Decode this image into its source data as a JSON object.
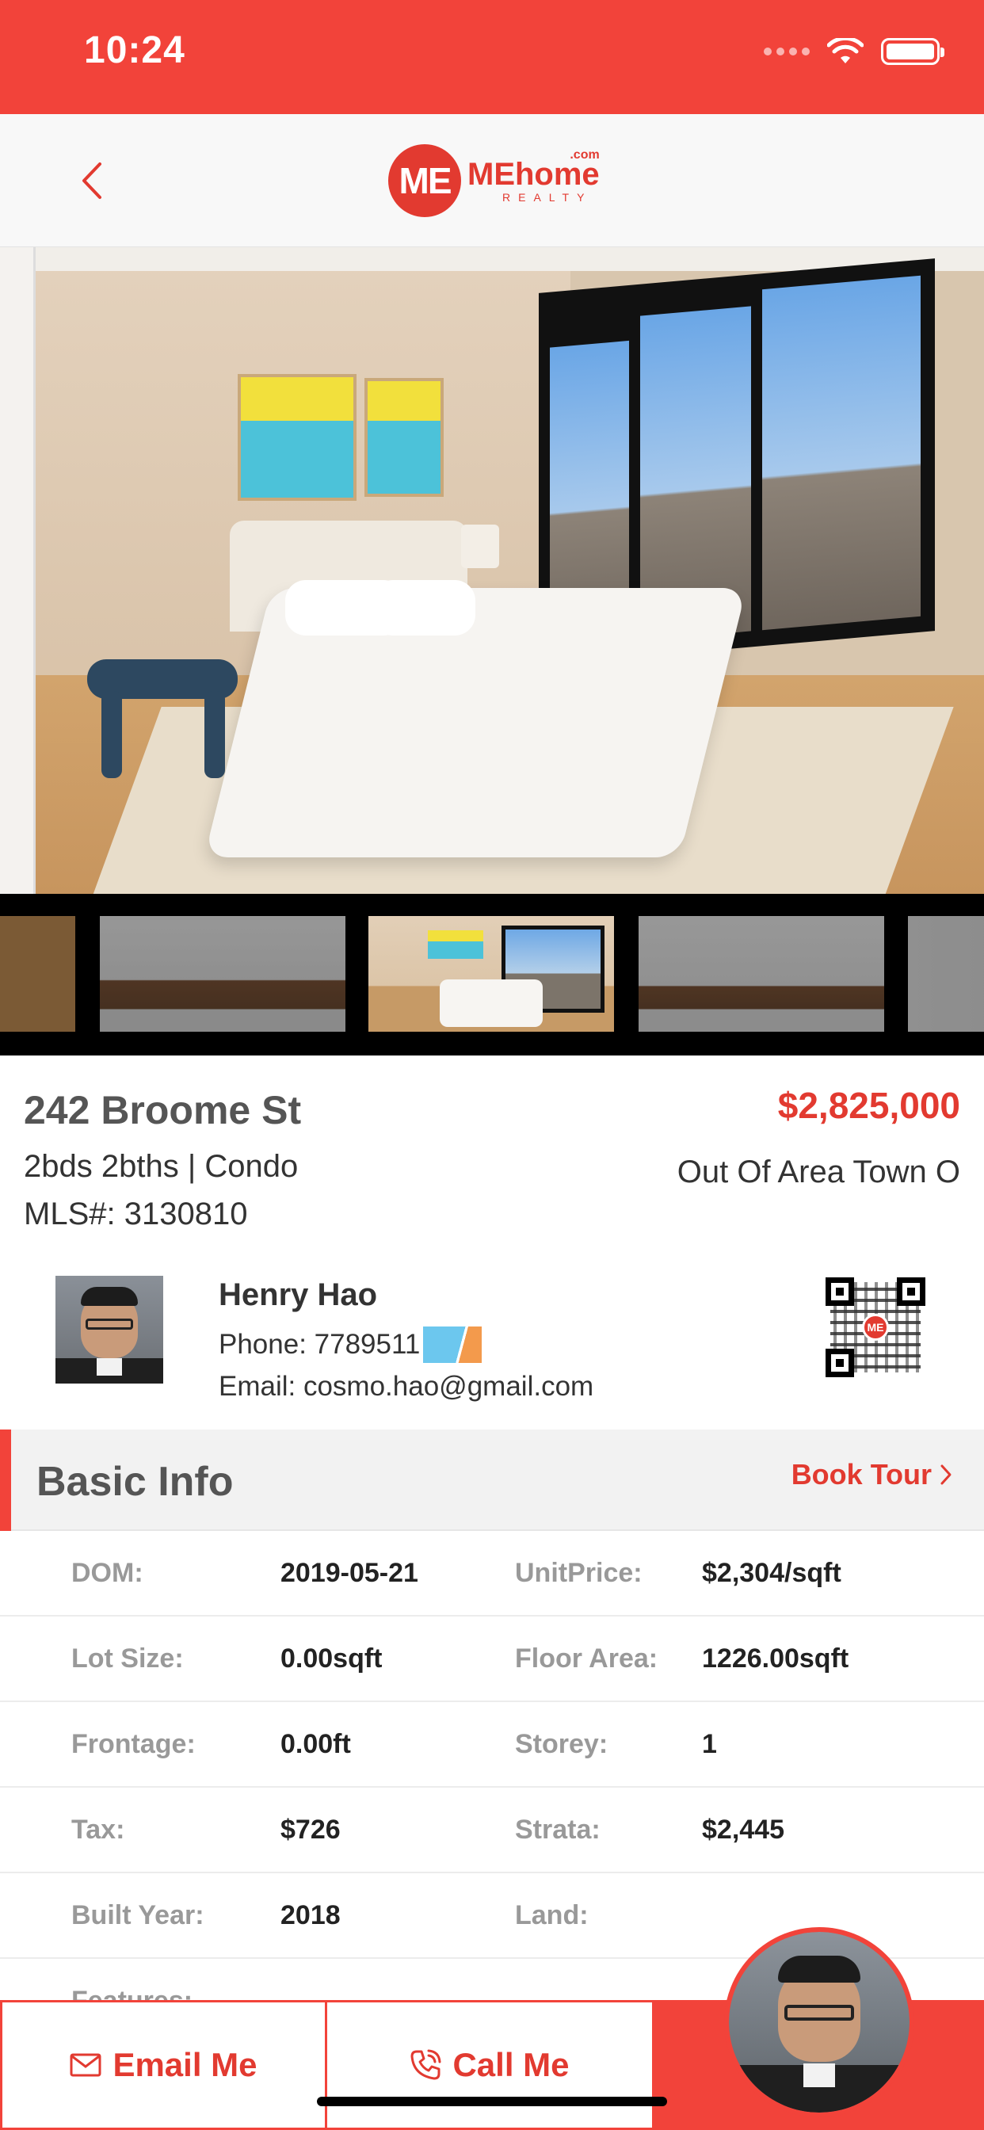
{
  "status_bar": {
    "time": "10:24"
  },
  "nav": {
    "back_icon": "chevron-left-icon",
    "logo_mark": "ME",
    "logo_name": "MEhome",
    "logo_com": ".com",
    "logo_sub": "REALTY"
  },
  "listing": {
    "address": "242 Broome St",
    "price": "$2,825,000",
    "specs": "2bds 2bths | Condo",
    "mls": "MLS#: 3130810",
    "town": "Out Of Area Town O"
  },
  "agent": {
    "name": "Henry Hao",
    "phone": "Phone: 7789511",
    "email": "Email: cosmo.hao@gmail.com",
    "qr_logo": "ME"
  },
  "basic_info": {
    "title": "Basic Info",
    "book_tour": "Book Tour",
    "rows": [
      {
        "l1": "DOM:",
        "v1": "2019-05-21",
        "l2": "UnitPrice:",
        "v2": "$2,304/sqft"
      },
      {
        "l1": "Lot Size:",
        "v1": "0.00sqft",
        "l2": "Floor Area:",
        "v2": "1226.00sqft"
      },
      {
        "l1": "Frontage:",
        "v1": "0.00ft",
        "l2": "Storey:",
        "v2": "1"
      },
      {
        "l1": "Tax:",
        "v1": "$726",
        "l2": "Strata:",
        "v2": "$2,445"
      },
      {
        "l1": "Built Year:",
        "v1": "2018",
        "l2": "Land:",
        "v2": ""
      },
      {
        "l1": "Features:",
        "v1": "",
        "l2": "",
        "v2": ""
      }
    ]
  },
  "actions": {
    "email_label": "Email Me",
    "call_label": "Call Me"
  },
  "colors": {
    "brand_red": "#f2433a",
    "accent_red": "#e23a30"
  }
}
